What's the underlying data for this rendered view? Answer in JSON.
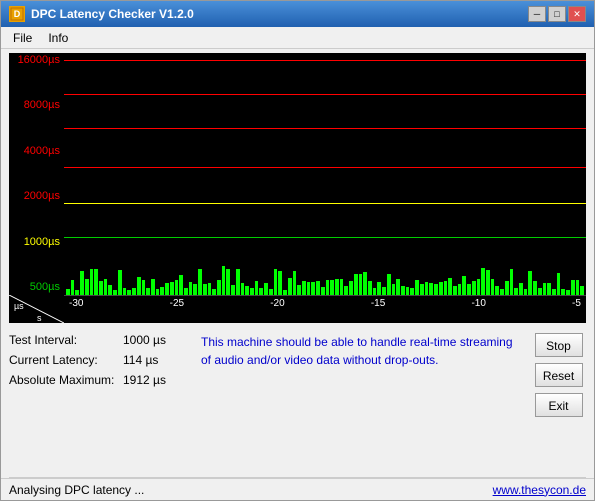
{
  "window": {
    "title": "DPC Latency Checker V1.2.0",
    "min_btn": "─",
    "max_btn": "□",
    "close_btn": "✕"
  },
  "menu": {
    "file_label": "File",
    "info_label": "Info"
  },
  "chart": {
    "y_labels": [
      {
        "value": "16000µs",
        "color": "red"
      },
      {
        "value": "8000µs",
        "color": "red"
      },
      {
        "value": "4000µs",
        "color": "red"
      },
      {
        "value": "2000µs",
        "color": "red"
      },
      {
        "value": "1000µs",
        "color": "yellow"
      },
      {
        "value": "500µs",
        "color": "green"
      }
    ],
    "x_labels": [
      "-30",
      "-25",
      "-20",
      "-15",
      "-10",
      "-5"
    ],
    "x_unit": "µs",
    "x_unit2": "s"
  },
  "stats": {
    "test_interval_label": "Test Interval:",
    "test_interval_value": "1000 µs",
    "current_latency_label": "Current Latency:",
    "current_latency_value": "114 µs",
    "absolute_max_label": "Absolute Maximum:",
    "absolute_max_value": "1912 µs"
  },
  "message": "This machine should be able to handle real-time streaming of audio and/or video data without drop-outs.",
  "buttons": {
    "stop": "Stop",
    "reset": "Reset",
    "exit": "Exit"
  },
  "status": {
    "left": "Analysing DPC latency ...",
    "right": "www.thesycon.de"
  }
}
